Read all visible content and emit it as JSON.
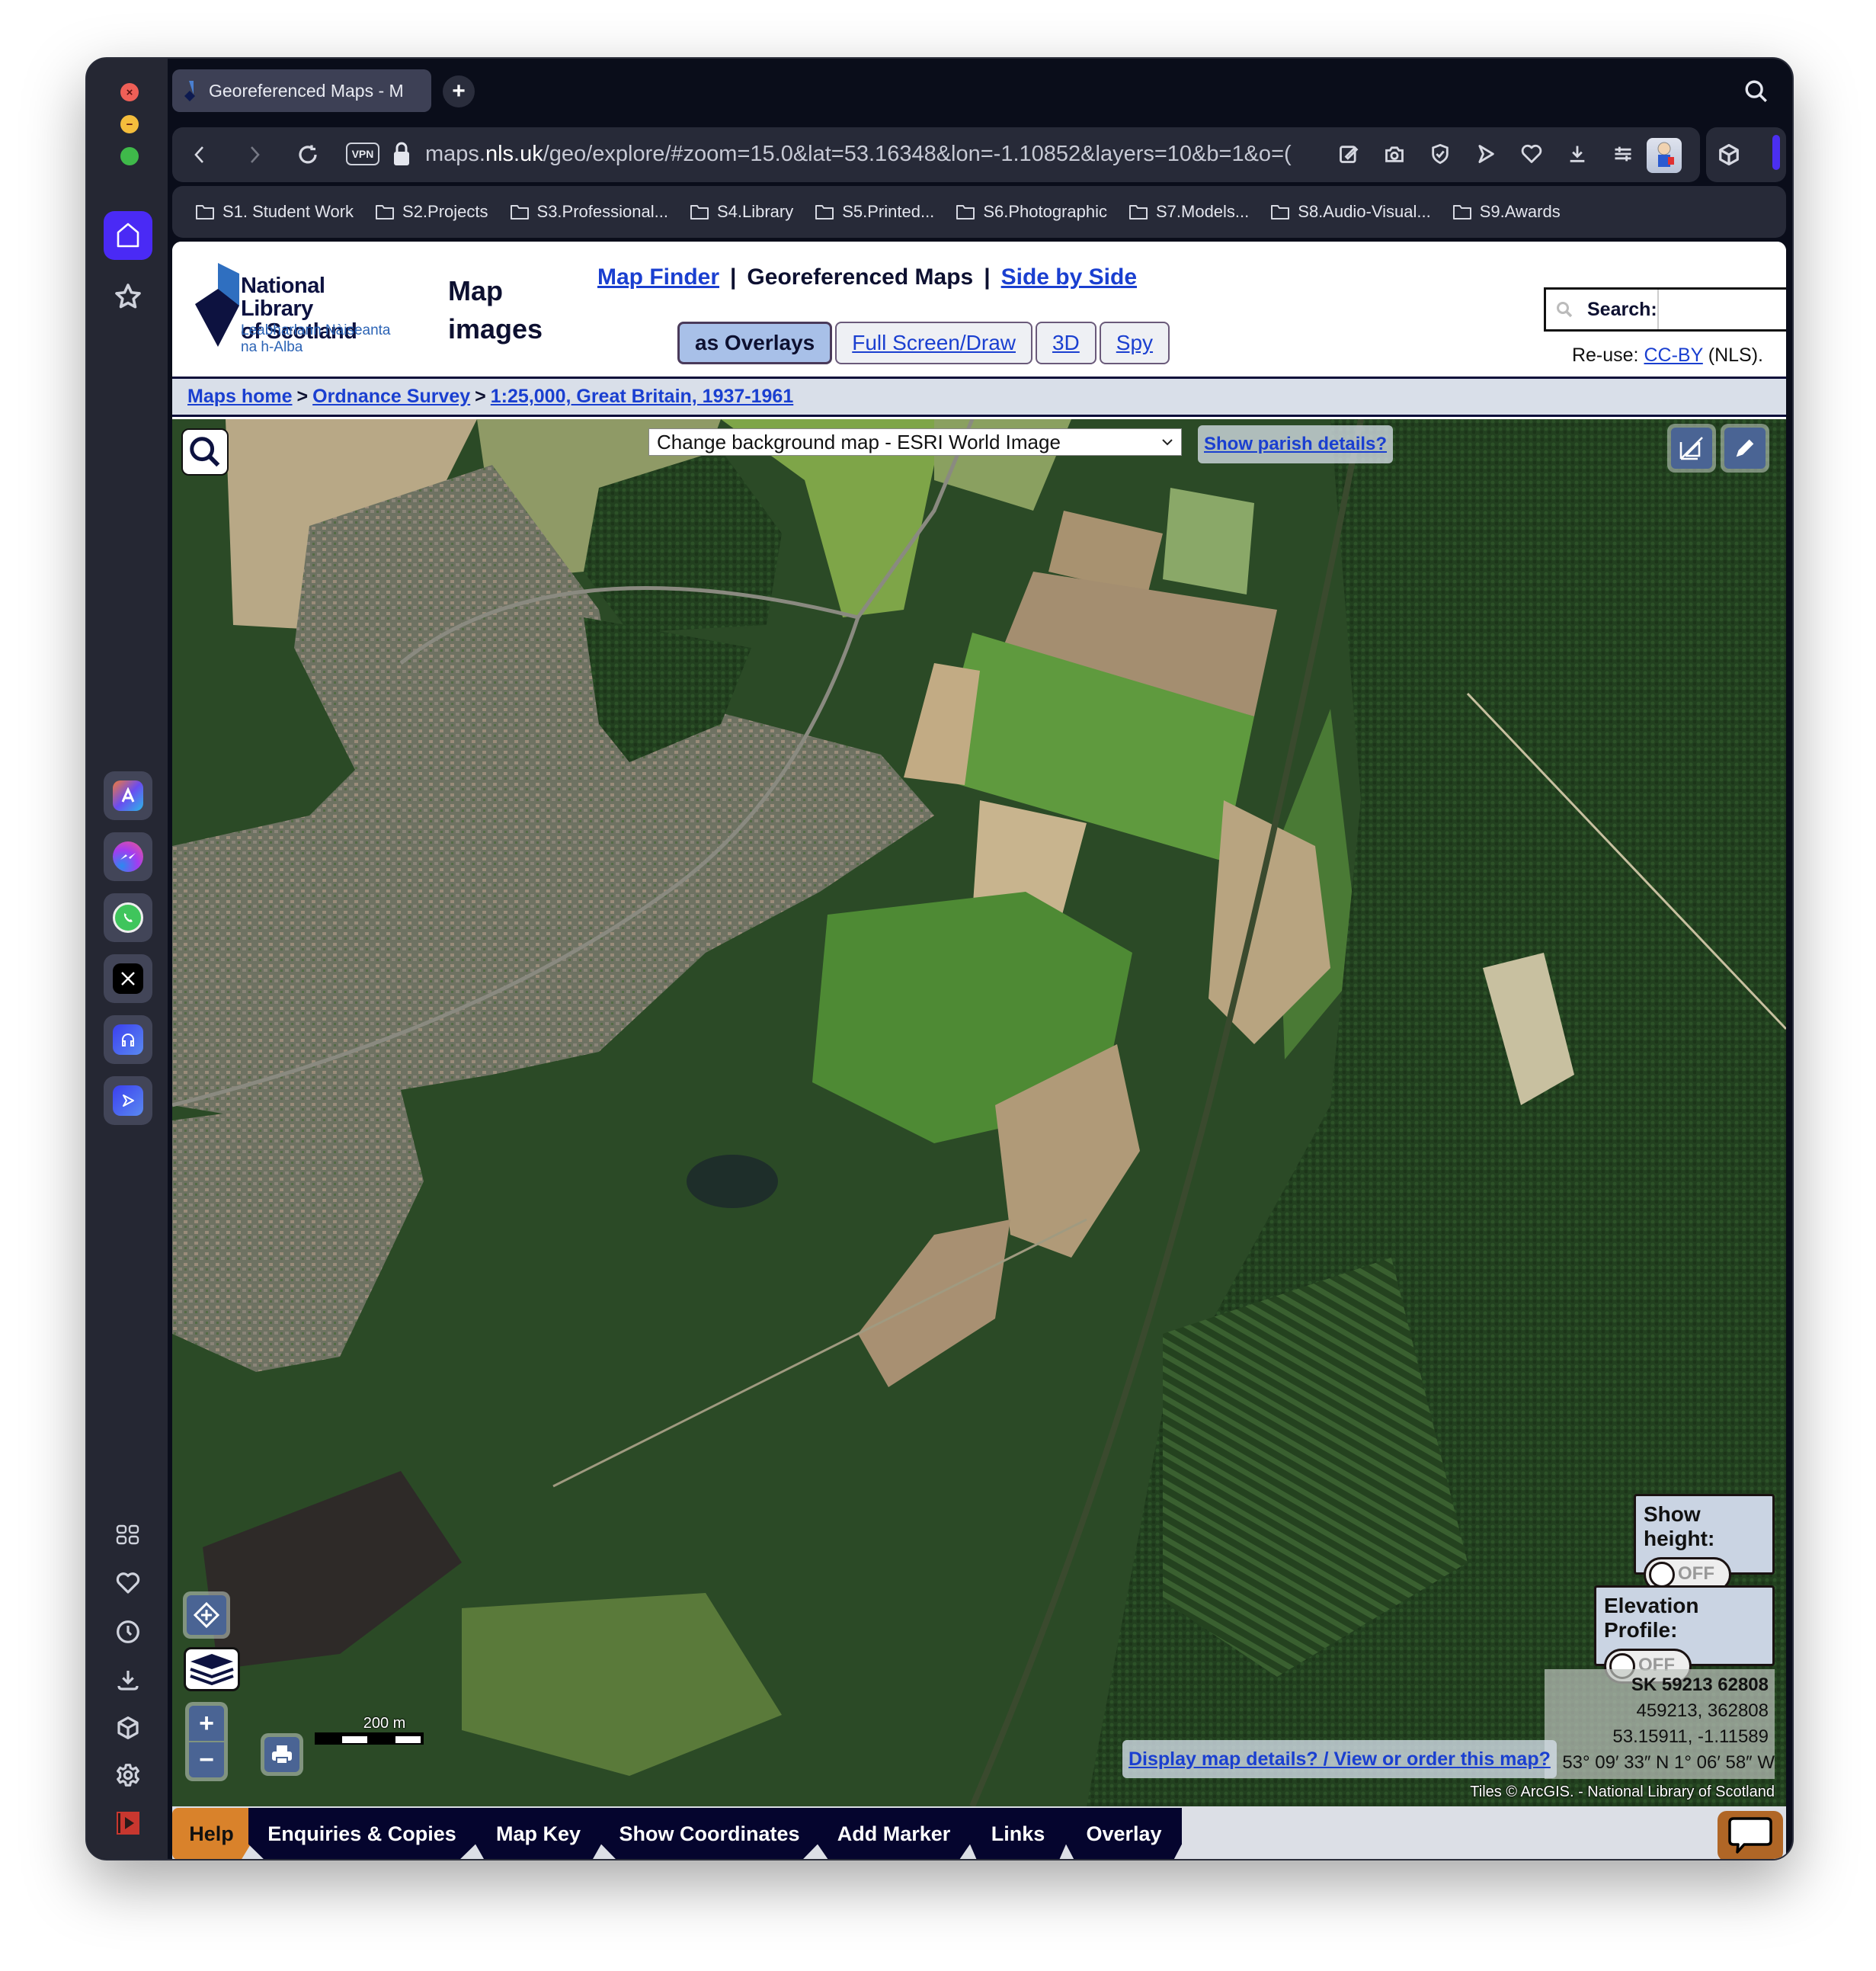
{
  "window_controls": {
    "close": "close",
    "minimize": "minimize",
    "zoom": "zoom"
  },
  "browser": {
    "tab_title": "Georeferenced Maps - M",
    "url_host": "maps.",
    "url_domain": "nls.uk",
    "url_path": "/geo/explore/#zoom=15.0&lat=53.16348&lon=-1.10852&layers=10&b=1&o=(",
    "vpn_label": "VPN",
    "bookmarks": [
      {
        "label": "S1. Student Work"
      },
      {
        "label": "S2.Projects"
      },
      {
        "label": "S3.Professional..."
      },
      {
        "label": "S4.Library"
      },
      {
        "label": "S5.Printed..."
      },
      {
        "label": "S6.Photographic"
      },
      {
        "label": "S7.Models..."
      },
      {
        "label": "S8.Audio-Visual..."
      },
      {
        "label": "S9.Awards"
      }
    ],
    "toolbar_icons": [
      "edit-icon",
      "camera-icon",
      "shield-icon",
      "send-icon",
      "heart-icon",
      "download-icon",
      "sliders-icon"
    ],
    "sidebar_apps": [
      "aria-icon",
      "messenger-icon",
      "whatsapp-icon",
      "x-icon",
      "music-icon",
      "player-icon"
    ],
    "sidebar_tools": [
      "tabs-icon",
      "heart-icon",
      "history-icon",
      "download-icon",
      "box-icon",
      "settings-icon",
      "video-icon",
      "more-icon"
    ]
  },
  "header": {
    "logo_line1": "National Library",
    "logo_line2": "of Scotland",
    "logo_gaelic1": "Leabharlann Nàiseanta",
    "logo_gaelic2": "na h-Alba",
    "section_title_1": "Map",
    "section_title_2": "images",
    "nav": {
      "map_finder": "Map Finder",
      "separator": "|",
      "georeferenced": "Georeferenced Maps",
      "side_by_side": "Side by Side"
    },
    "view_tabs": [
      {
        "label": "as Overlays",
        "active": true
      },
      {
        "label": "Full Screen/Draw",
        "active": false
      },
      {
        "label": "3D",
        "active": false
      },
      {
        "label": "Spy",
        "active": false
      }
    ],
    "search_label": "Search:",
    "search_value": "",
    "reuse_prefix": "Re-use:",
    "reuse_link": "CC-BY",
    "reuse_suffix": "(NLS)."
  },
  "breadcrumb": [
    {
      "label": "Maps home"
    },
    {
      "label": "Ordnance Survey"
    },
    {
      "label": "1:25,000, Great Britain, 1937-1961"
    }
  ],
  "breadcrumb_sep": ">",
  "map": {
    "background_select": "Change background map - ESRI World Image",
    "parish_link": "Show parish details?",
    "show_height_label": "Show height:",
    "show_height_state": "OFF",
    "elevation_label": "Elevation Profile:",
    "elevation_state": "OFF",
    "coords": {
      "os_grid": "SK 59213 62808",
      "easting_northing": "459213, 362808",
      "latlon": "53.15911, -1.11589",
      "dms": "53° 09′ 33″ N 1° 06′ 58″ W"
    },
    "details_link": "Display map details? / View or order this map?",
    "attribution": "Tiles © ArcGIS. - National Library of Scotland",
    "scale_label": "200 m",
    "zoom_in": "+",
    "zoom_out": "−"
  },
  "bottom_tabs": [
    {
      "label": "Help"
    },
    {
      "label": "Enquiries & Copies"
    },
    {
      "label": "Map Key"
    },
    {
      "label": "Show Coordinates"
    },
    {
      "label": "Add Marker"
    },
    {
      "label": "Links"
    },
    {
      "label": "Overlay"
    }
  ],
  "colors": {
    "brand_navy": "#05052e",
    "link_blue": "#1a3fd0",
    "help_orange": "#d9822b",
    "active_tab": "#a8c0e8",
    "browser_accent": "#4b2ff0"
  }
}
